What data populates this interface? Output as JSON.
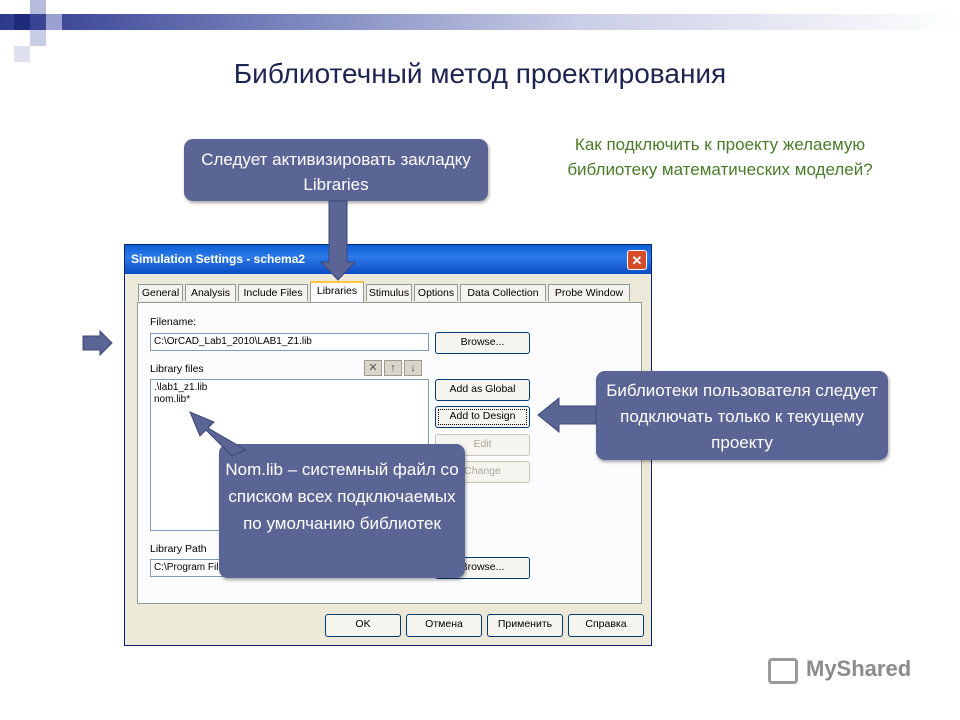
{
  "slide": {
    "title": "Библиотечный метод проектирования",
    "question": "Как подключить к проекту желаемую библиотеку математических моделей?",
    "callout_libraries_tab": "Следует активизировать закладку Libraries",
    "callout_user_libs": "Библиотеки пользователя следует подключать только к текущему проекту",
    "callout_nomlib": "Nom.lib – системный файл со списком всех подключаемых по умолчанию библиотек",
    "watermark": "MyShared"
  },
  "dialog": {
    "title": "Simulation Settings - schema2",
    "close": "✕",
    "tabs": [
      "General",
      "Analysis",
      "Include Files",
      "Libraries",
      "Stimulus",
      "Options",
      "Data Collection",
      "Probe Window"
    ],
    "active_tab": "Libraries",
    "filename_label": "Filename:",
    "filename_value": "C:\\OrCAD_Lab1_2010\\LAB1_Z1.lib",
    "browse_label": "Browse...",
    "library_files_label": "Library files",
    "library_files": [
      ".\\lab1_z1.lib",
      "nom.lib*"
    ],
    "tool_delete": "✕",
    "tool_up": "↑",
    "tool_down": "↓",
    "add_global_label": "Add as Global",
    "add_design_label": "Add to Design",
    "edit_label": "Edit",
    "change_label": "Change",
    "library_path_label": "Library Path",
    "library_path_value": "C:\\Program Fil",
    "browse2_label": "Browse...",
    "ok_label": "OK",
    "cancel_label": "Отмена",
    "apply_label": "Применить",
    "help_label": "Справка"
  }
}
